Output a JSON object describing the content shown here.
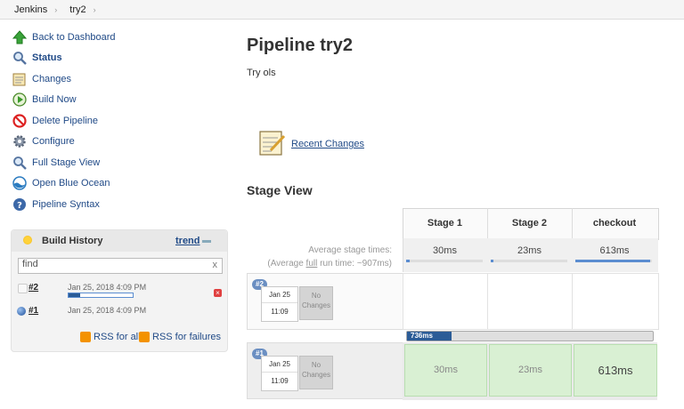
{
  "breadcrumb": [
    "Jenkins",
    "try2"
  ],
  "sidebar": {
    "items": [
      {
        "label": "Back to Dashboard",
        "icon": "up-arrow-icon"
      },
      {
        "label": "Status",
        "icon": "magnifier-icon"
      },
      {
        "label": "Changes",
        "icon": "notepad-icon"
      },
      {
        "label": "Build Now",
        "icon": "clock-play-icon"
      },
      {
        "label": "Delete Pipeline",
        "icon": "no-entry-icon"
      },
      {
        "label": "Configure",
        "icon": "gear-icon"
      },
      {
        "label": "Full Stage View",
        "icon": "magnifier-icon"
      },
      {
        "label": "Open Blue Ocean",
        "icon": "blue-ocean-icon"
      },
      {
        "label": "Pipeline Syntax",
        "icon": "help-icon"
      }
    ]
  },
  "build_history": {
    "title": "Build History",
    "trend_label": "trend",
    "find_placeholder": "find",
    "find_clear": "x",
    "builds": [
      {
        "number": "#2",
        "date": "Jan 25, 2018 4:09 PM",
        "in_progress": true
      },
      {
        "number": "#1",
        "date": "Jan 25, 2018 4:09 PM",
        "in_progress": false
      }
    ],
    "rss_all": "RSS for all",
    "rss_failures": "RSS for failures"
  },
  "main": {
    "title": "Pipeline try2",
    "description": "Try ols",
    "recent_changes": "Recent Changes",
    "stage_view_title": "Stage View",
    "avg_stage_times": "Average stage times:",
    "avg_full_prefix": "(Average ",
    "avg_full_word": "full",
    "avg_full_suffix": " run time: ~907ms)"
  },
  "stages": [
    {
      "name": "Stage 1",
      "avg": "30ms",
      "build1": "30ms"
    },
    {
      "name": "Stage 2",
      "avg": "23ms",
      "build1": "23ms"
    },
    {
      "name": "checkout",
      "avg": "613ms",
      "build1": "613ms"
    }
  ],
  "stage_builds": [
    {
      "badge": "#2",
      "date": "Jan 25",
      "time": "11:09",
      "changes": "No Changes",
      "progress_label": "736ms"
    },
    {
      "badge": "#1",
      "date": "Jan 25",
      "time": "11:09",
      "changes": "No Changes"
    }
  ],
  "colors": {
    "link": "#204a87",
    "success": "#d9f0d3",
    "progress": "#2b5c97"
  }
}
